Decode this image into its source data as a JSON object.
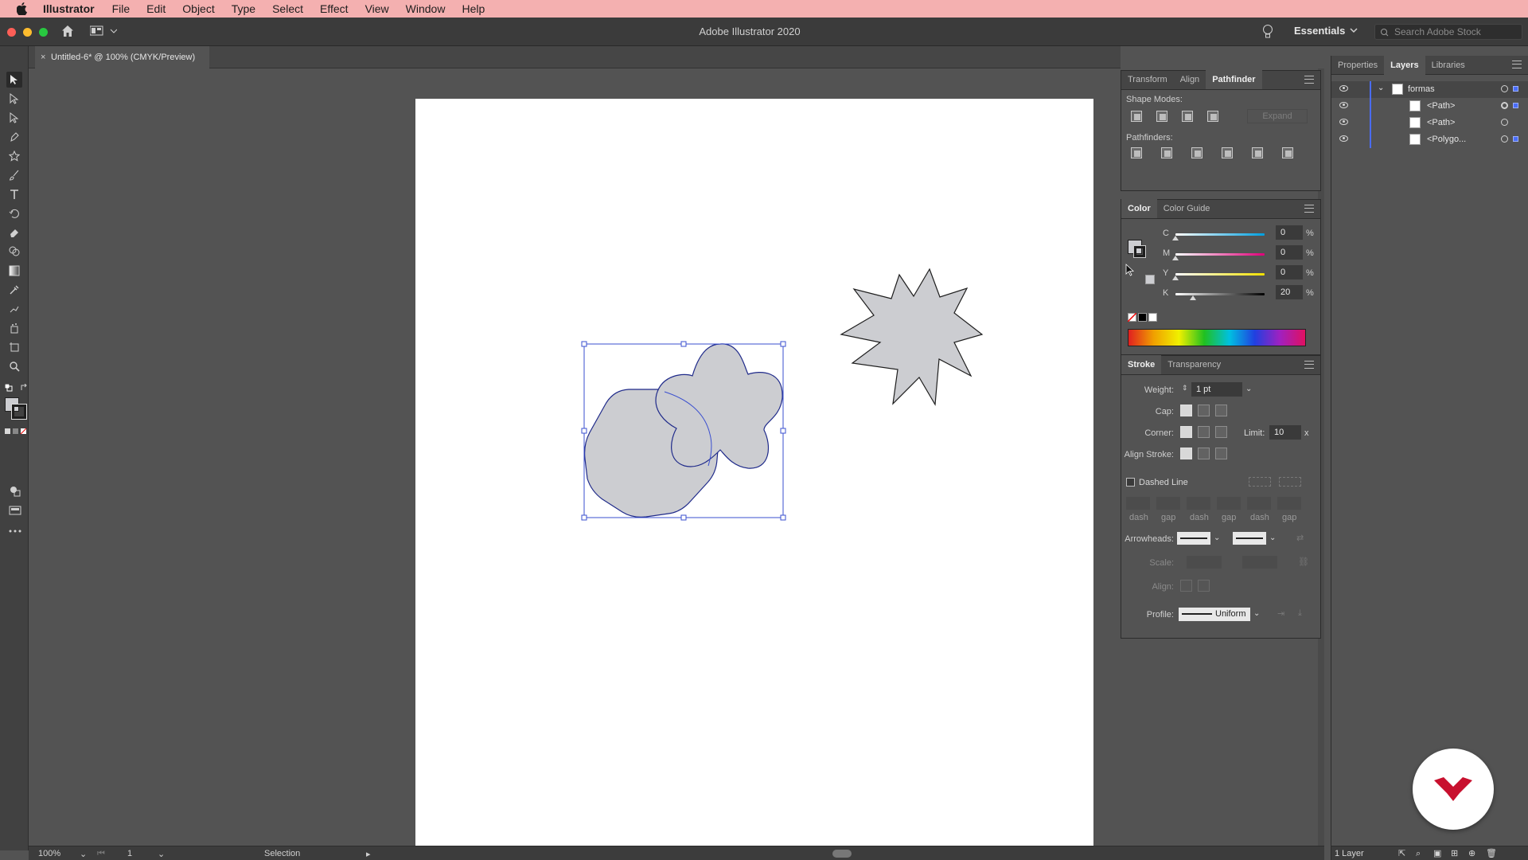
{
  "menubar": {
    "app": "Illustrator",
    "items": [
      "File",
      "Edit",
      "Object",
      "Type",
      "Select",
      "Effect",
      "View",
      "Window",
      "Help"
    ]
  },
  "appbar": {
    "title": "Adobe Illustrator 2020",
    "workspace": "Essentials",
    "search_placeholder": "Search Adobe Stock"
  },
  "document": {
    "tab_label": "Untitled-6* @ 100% (CMYK/Preview)"
  },
  "pathfinder": {
    "tabs": [
      "Transform",
      "Align",
      "Pathfinder"
    ],
    "active_tab": "Pathfinder",
    "shape_modes_label": "Shape Modes:",
    "pathfinders_label": "Pathfinders:",
    "expand_label": "Expand"
  },
  "color": {
    "tabs": [
      "Color",
      "Color Guide"
    ],
    "channels": [
      {
        "name": "C",
        "value": "0",
        "level": 0
      },
      {
        "name": "M",
        "value": "0",
        "level": 0
      },
      {
        "name": "Y",
        "value": "0",
        "level": 0
      },
      {
        "name": "K",
        "value": "20",
        "level": 20
      }
    ],
    "unit": "%"
  },
  "stroke": {
    "tabs": [
      "Stroke",
      "Transparency"
    ],
    "weight_label": "Weight:",
    "weight_value": "1 pt",
    "cap_label": "Cap:",
    "corner_label": "Corner:",
    "limit_label": "Limit:",
    "limit_value": "10",
    "limit_unit": "x",
    "align_stroke_label": "Align Stroke:",
    "dashed_label": "Dashed Line",
    "dash_labels": [
      "dash",
      "gap",
      "dash",
      "gap",
      "dash",
      "gap"
    ],
    "arrowheads_label": "Arrowheads:",
    "scale_label": "Scale:",
    "align_label": "Align:",
    "profile_label": "Profile:",
    "profile_value": "Uniform"
  },
  "layers": {
    "tabs": [
      "Properties",
      "Layers",
      "Libraries"
    ],
    "active_tab": "Layers",
    "rows": [
      {
        "name": "formas"
      },
      {
        "name": "<Path>"
      },
      {
        "name": "<Path>"
      },
      {
        "name": "<Polygo..."
      }
    ],
    "status": "1 Layer"
  },
  "statusbar": {
    "zoom": "100%",
    "artboard": "1",
    "tool": "Selection"
  },
  "colors": {
    "shape_fill": "#cccdd1",
    "selection": "#3a4fcf",
    "logo_red": "#c8102e"
  }
}
